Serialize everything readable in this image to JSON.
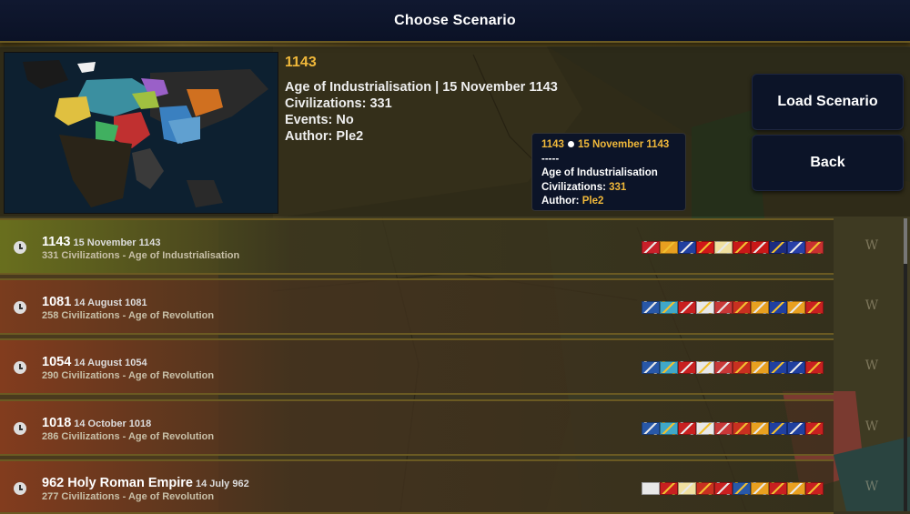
{
  "header": {
    "title": "Choose Scenario"
  },
  "selected": {
    "year": "1143",
    "age_line": "Age of Industrialisation | 15 November 1143",
    "civilizations": "Civilizations: 331",
    "events": "Events: No",
    "author": "Author: Ple2"
  },
  "buttons": {
    "load": "Load Scenario",
    "back": "Back"
  },
  "tooltip": {
    "year": "1143",
    "date": "15 November 1143",
    "separator": "-----",
    "age": "Age of Industrialisation",
    "civ_label": "Civilizations: ",
    "civ_value": "331",
    "author_label": "Author: ",
    "author_value": "Ple2"
  },
  "scenarios": [
    {
      "name": "1143",
      "date": "15 November 1143",
      "sub": "331 Civilizations - Age of Industrialisation",
      "flags": [
        "#c8202a",
        "#e8a020",
        "#2040a0",
        "#d01818",
        "#f0e0a0",
        "#c81818",
        "#c81818",
        "#1c2c80",
        "#2840a8",
        "#c83030"
      ]
    },
    {
      "name": "1081",
      "date": "14 August 1081",
      "sub": "258 Civilizations - Age of Revolution",
      "flags": [
        "#2858a8",
        "#40a8c8",
        "#c82020",
        "#e8e8e8",
        "#c83838",
        "#c83020",
        "#e8a020",
        "#2040a0",
        "#e8a020",
        "#c82020"
      ]
    },
    {
      "name": "1054",
      "date": "14 August 1054",
      "sub": "290 Civilizations - Age of Revolution",
      "flags": [
        "#2858a8",
        "#40a8c8",
        "#c82020",
        "#e8e8e8",
        "#c83838",
        "#c83020",
        "#e8a020",
        "#2040a0",
        "#2040a0",
        "#c82020"
      ]
    },
    {
      "name": "1018",
      "date": "14 October 1018",
      "sub": "286 Civilizations - Age of Revolution",
      "flags": [
        "#2858a8",
        "#40a8c8",
        "#c82020",
        "#e8e8e8",
        "#c83838",
        "#c83020",
        "#e8a020",
        "#2040a0",
        "#2040a0",
        "#c82020"
      ]
    },
    {
      "name": "962 Holy Roman Empire",
      "date": "14 July 962",
      "sub": "277 Civilizations - Age of Revolution",
      "flags": [
        "#e8e8e8",
        "#c82020",
        "#f0e0a0",
        "#c83020",
        "#c82020",
        "#2858a8",
        "#e8a020",
        "#c82020",
        "#e8a020",
        "#c82020"
      ]
    }
  ],
  "colors": {
    "accent_gold": "#f0b83a",
    "button_bg": "#0c1428",
    "row_border": "#6b5a22"
  },
  "icons": {
    "row_icon": "clock-icon",
    "wiki_icon": "wiki-icon"
  }
}
